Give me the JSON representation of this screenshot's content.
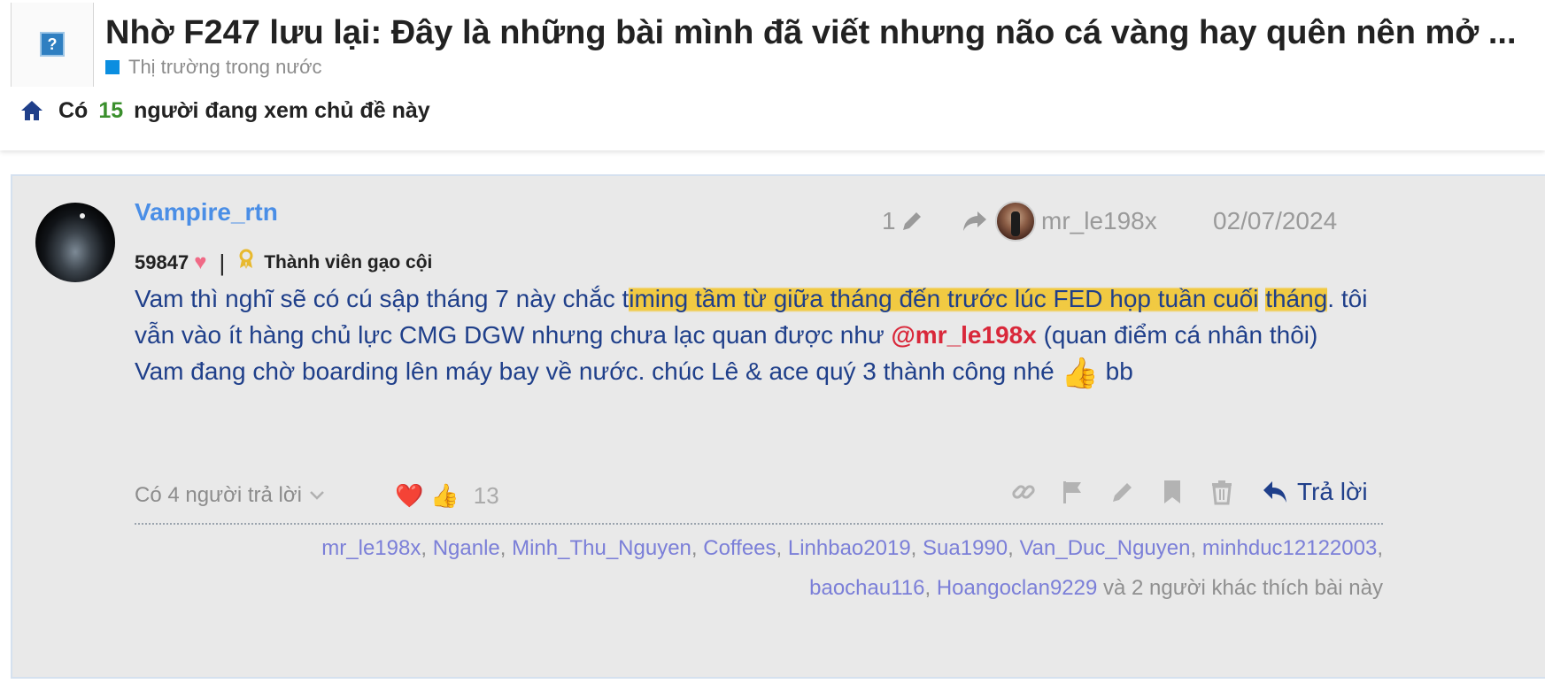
{
  "thread": {
    "title": "Nhờ F247 lưu lại: Đây là những bài mình đã viết nhưng não cá vàng hay quên nên mở ...",
    "category": "Thị trường trong nước",
    "category_color": "#0b8ee0",
    "viewers_prefix": "Có",
    "viewers_count": "15",
    "viewers_suffix": "người đang xem chủ đề này"
  },
  "post": {
    "username": "Vampire_rtn",
    "likes_received": "59847",
    "rank": "Thành viên gạo cội",
    "edit_count": "1",
    "reply_to_user": "mr_le198x",
    "date": "02/07/2024",
    "body": {
      "p1_a": "Vam thì nghĩ sẽ có cú sập tháng 7 này chắc t",
      "p1_hl1": "iming tầm từ giữa tháng đến trước lúc FED họp tuần cuối",
      "p1_b": " ",
      "p1_hl2": "tháng",
      "p1_c": ". tôi vẫn vào ít hàng chủ lực CMG DGW nhưng chưa lạc quan được như ",
      "mention": "@mr_le198x",
      "p1_d": " (quan điểm cá nhân thôi)",
      "p2_a": "Vam đang chờ boarding lên máy bay về nước. chúc Lê & ace quý 3 thành công nhé ",
      "p2_emoji": "👍",
      "p2_b": " bb"
    },
    "replies_label": "Có 4 người trả lời",
    "reactions": [
      "❤️",
      "👍"
    ],
    "reaction_count": "13",
    "reply_button": "Trả lời",
    "liked_by": [
      "mr_le198x",
      "Nganle",
      "Minh_Thu_Nguyen",
      "Coffees",
      "Linhbao2019",
      "Sua1990",
      "Van_Duc_Nguyen",
      "minhduc12122003",
      "baochau116",
      "Hoangoclan9229"
    ],
    "liked_by_suffix": "và 2 người khác thích bài này"
  },
  "colors": {
    "username": "#4a8ee6",
    "body_text": "#1f3f8a",
    "mention": "#d9283a",
    "highlight": "#f2c630",
    "viewer_count": "#3a8f2c",
    "like_user": "#7b7fd8"
  },
  "icons": {
    "home": "home-icon",
    "edit": "pencil-icon",
    "reply_arrow": "share-arrow-icon",
    "link": "link-icon",
    "flag": "flag-icon",
    "edit_action": "pencil-icon",
    "bookmark": "bookmark-icon",
    "delete": "trash-icon",
    "reply": "reply-icon"
  }
}
